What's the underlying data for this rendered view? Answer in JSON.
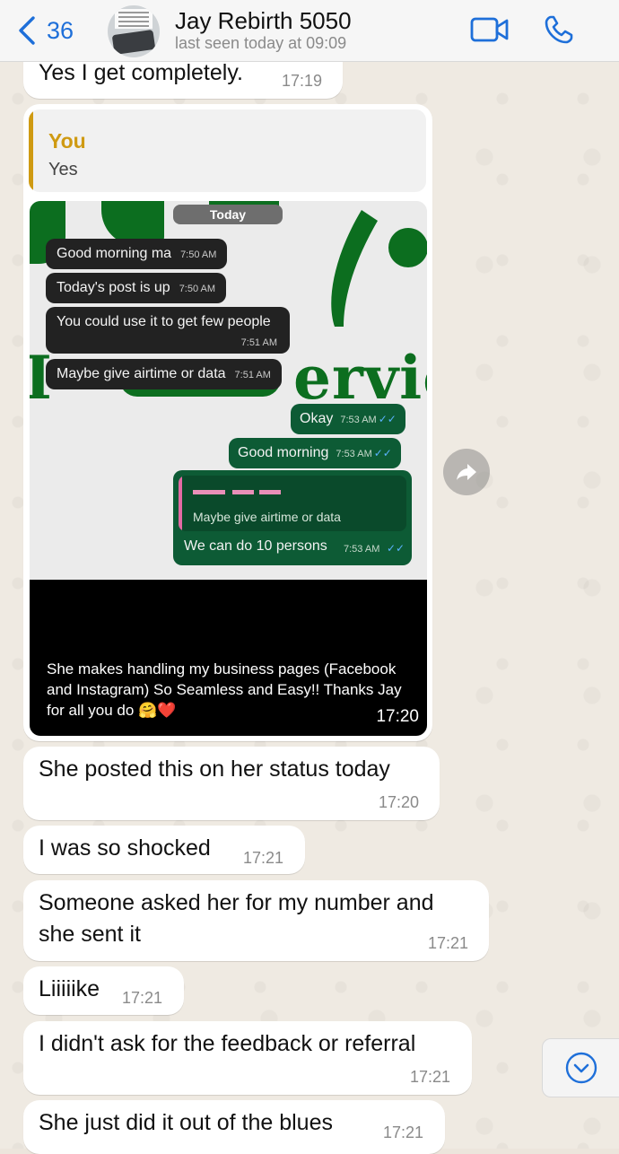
{
  "header": {
    "back_count": "36",
    "contact_name": "Jay Rebirth 5050",
    "contact_status": "last seen today at 09:09",
    "icons": {
      "back": "chevron-left-icon",
      "video": "video-call-icon",
      "call": "phone-icon"
    },
    "accent_color": "#1e6fd9"
  },
  "messages": {
    "m1": {
      "text": "Yes I get completely.",
      "time": "17:19"
    },
    "reply": {
      "quote_author": "You",
      "quote_text": "Yes",
      "image": {
        "brand_partial_text": "ervic",
        "date_label": "Today",
        "incoming": [
          {
            "text": "Good morning ma",
            "time": "7:50 AM"
          },
          {
            "text": "Today's post is up",
            "time": "7:50 AM"
          },
          {
            "text": "You could use it to get few people",
            "time": "7:51 AM"
          },
          {
            "text": "Maybe give airtime or data",
            "time": "7:51 AM"
          }
        ],
        "outgoing": [
          {
            "text": "Okay",
            "time": "7:53 AM"
          },
          {
            "text": "Good morning",
            "time": "7:53 AM"
          }
        ],
        "reply_quote_text": "Maybe give airtime or data",
        "reply_text": "We can do 10 persons",
        "reply_time": "7:53 AM",
        "caption": "She makes handling my business pages (Facebook and Instagram) So Seamless and Easy!! Thanks Jay for all you do 🤗❤️"
      },
      "time": "17:20"
    },
    "m2": {
      "text": "She posted this on her status today",
      "time": "17:20"
    },
    "m3": {
      "text": "I was so shocked",
      "time": "17:21"
    },
    "m4": {
      "line1": "Someone asked her for my number and",
      "line2": "she sent it",
      "time": "17:21"
    },
    "m5": {
      "text": "Liiiiike",
      "time": "17:21"
    },
    "m6": {
      "text": "I didn't ask for the feedback or referral",
      "time": "17:21"
    },
    "m7": {
      "text": "She just did it out of the blues",
      "time": "17:21"
    }
  },
  "controls": {
    "forward_icon": "forward-arrow-icon",
    "scroll_icon": "chevron-down-circle-icon"
  }
}
